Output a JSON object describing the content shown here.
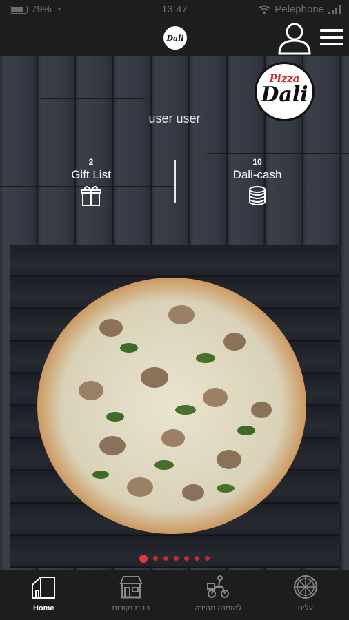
{
  "status_bar": {
    "battery": "79%",
    "time": "13:47",
    "carrier": "Pelephone"
  },
  "header": {
    "logo_text": "Dali"
  },
  "brand": {
    "logo_top": "Pizza",
    "logo_main": "Dali"
  },
  "profile": {
    "user_name": "user user",
    "gift_list": {
      "count": "2",
      "label": "Gift List"
    },
    "dali_cash": {
      "count": "10",
      "label": "Dali-cash"
    }
  },
  "carousel": {
    "slide_count": 7,
    "active_index": 0
  },
  "tabs": [
    {
      "label": "Home",
      "icon": "home-icon",
      "active": true
    },
    {
      "label": "חנות נקודות",
      "icon": "store-icon",
      "active": false
    },
    {
      "label": "להזמנה מהירה",
      "icon": "delivery-icon",
      "active": false
    },
    {
      "label": "עלינו",
      "icon": "pizza-icon",
      "active": false
    }
  ],
  "colors": {
    "accent": "#e7353b",
    "bar": "#1d1d1e"
  }
}
